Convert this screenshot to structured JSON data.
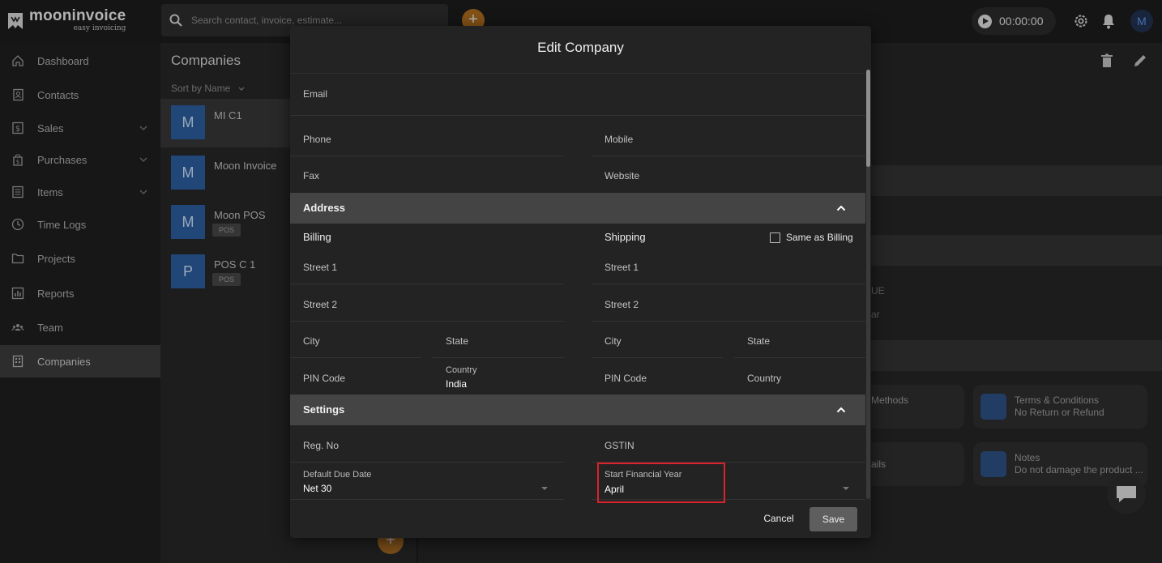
{
  "app": {
    "brand": "mooninvoice",
    "tagline": "easy invoicing",
    "search_placeholder": "Search contact, invoice, estimate...",
    "timer": "00:00:00",
    "avatar_initial": "M",
    "accent": "#b9731f"
  },
  "sidebar": {
    "items": [
      {
        "label": "Dashboard",
        "icon": "home-icon"
      },
      {
        "label": "Contacts",
        "icon": "contacts-icon"
      },
      {
        "label": "Sales",
        "icon": "sales-icon",
        "expandable": true
      },
      {
        "label": "Purchases",
        "icon": "purchases-icon",
        "expandable": true
      },
      {
        "label": "Items",
        "icon": "items-icon",
        "expandable": true
      },
      {
        "label": "Time Logs",
        "icon": "clock-icon"
      },
      {
        "label": "Projects",
        "icon": "folder-icon"
      },
      {
        "label": "Reports",
        "icon": "reports-icon"
      },
      {
        "label": "Team",
        "icon": "team-icon"
      },
      {
        "label": "Companies",
        "icon": "companies-icon",
        "active": true
      }
    ]
  },
  "companies": {
    "title": "Companies",
    "sort_label": "Sort by Name",
    "items": [
      {
        "initial": "M",
        "name": "MI C1",
        "badge": ""
      },
      {
        "initial": "M",
        "name": "Moon Invoice",
        "badge": ""
      },
      {
        "initial": "M",
        "name": "Moon POS",
        "badge": "POS"
      },
      {
        "initial": "P",
        "name": "POS C 1",
        "badge": "POS"
      }
    ]
  },
  "background": {
    "cards": [
      {
        "title": "Methods",
        "sub": ""
      },
      {
        "title": "Terms & Conditions",
        "sub": "No Return or Refund"
      },
      {
        "title": "ails",
        "sub": ""
      },
      {
        "title": "Notes",
        "sub": "Do not damage the product ..."
      }
    ],
    "partial_text_1": "UE",
    "partial_text_2": "ar"
  },
  "modal": {
    "title": "Edit Company",
    "fields": {
      "email": "Email",
      "phone": "Phone",
      "mobile": "Mobile",
      "fax": "Fax",
      "website": "Website"
    },
    "address": {
      "section_title": "Address",
      "billing": {
        "heading": "Billing",
        "street1": "Street 1",
        "street2": "Street 2",
        "city": "City",
        "state": "State",
        "pin": "PIN Code",
        "country_label": "Country",
        "country_value": "India"
      },
      "shipping": {
        "heading": "Shipping",
        "same_as_billing": "Same as Billing",
        "street1": "Street 1",
        "street2": "Street 2",
        "city": "City",
        "state": "State",
        "pin": "PIN Code",
        "country": "Country"
      }
    },
    "settings": {
      "section_title": "Settings",
      "reg_no": "Reg. No",
      "gstin": "GSTIN",
      "due_date_label": "Default Due Date",
      "due_date_value": "Net 30",
      "fin_year_label": "Start Financial Year",
      "fin_year_value": "April"
    },
    "buttons": {
      "cancel": "Cancel",
      "save": "Save"
    }
  },
  "colors": {
    "highlight": "#d9232b",
    "avatar_blue": "#2a5b9a"
  }
}
